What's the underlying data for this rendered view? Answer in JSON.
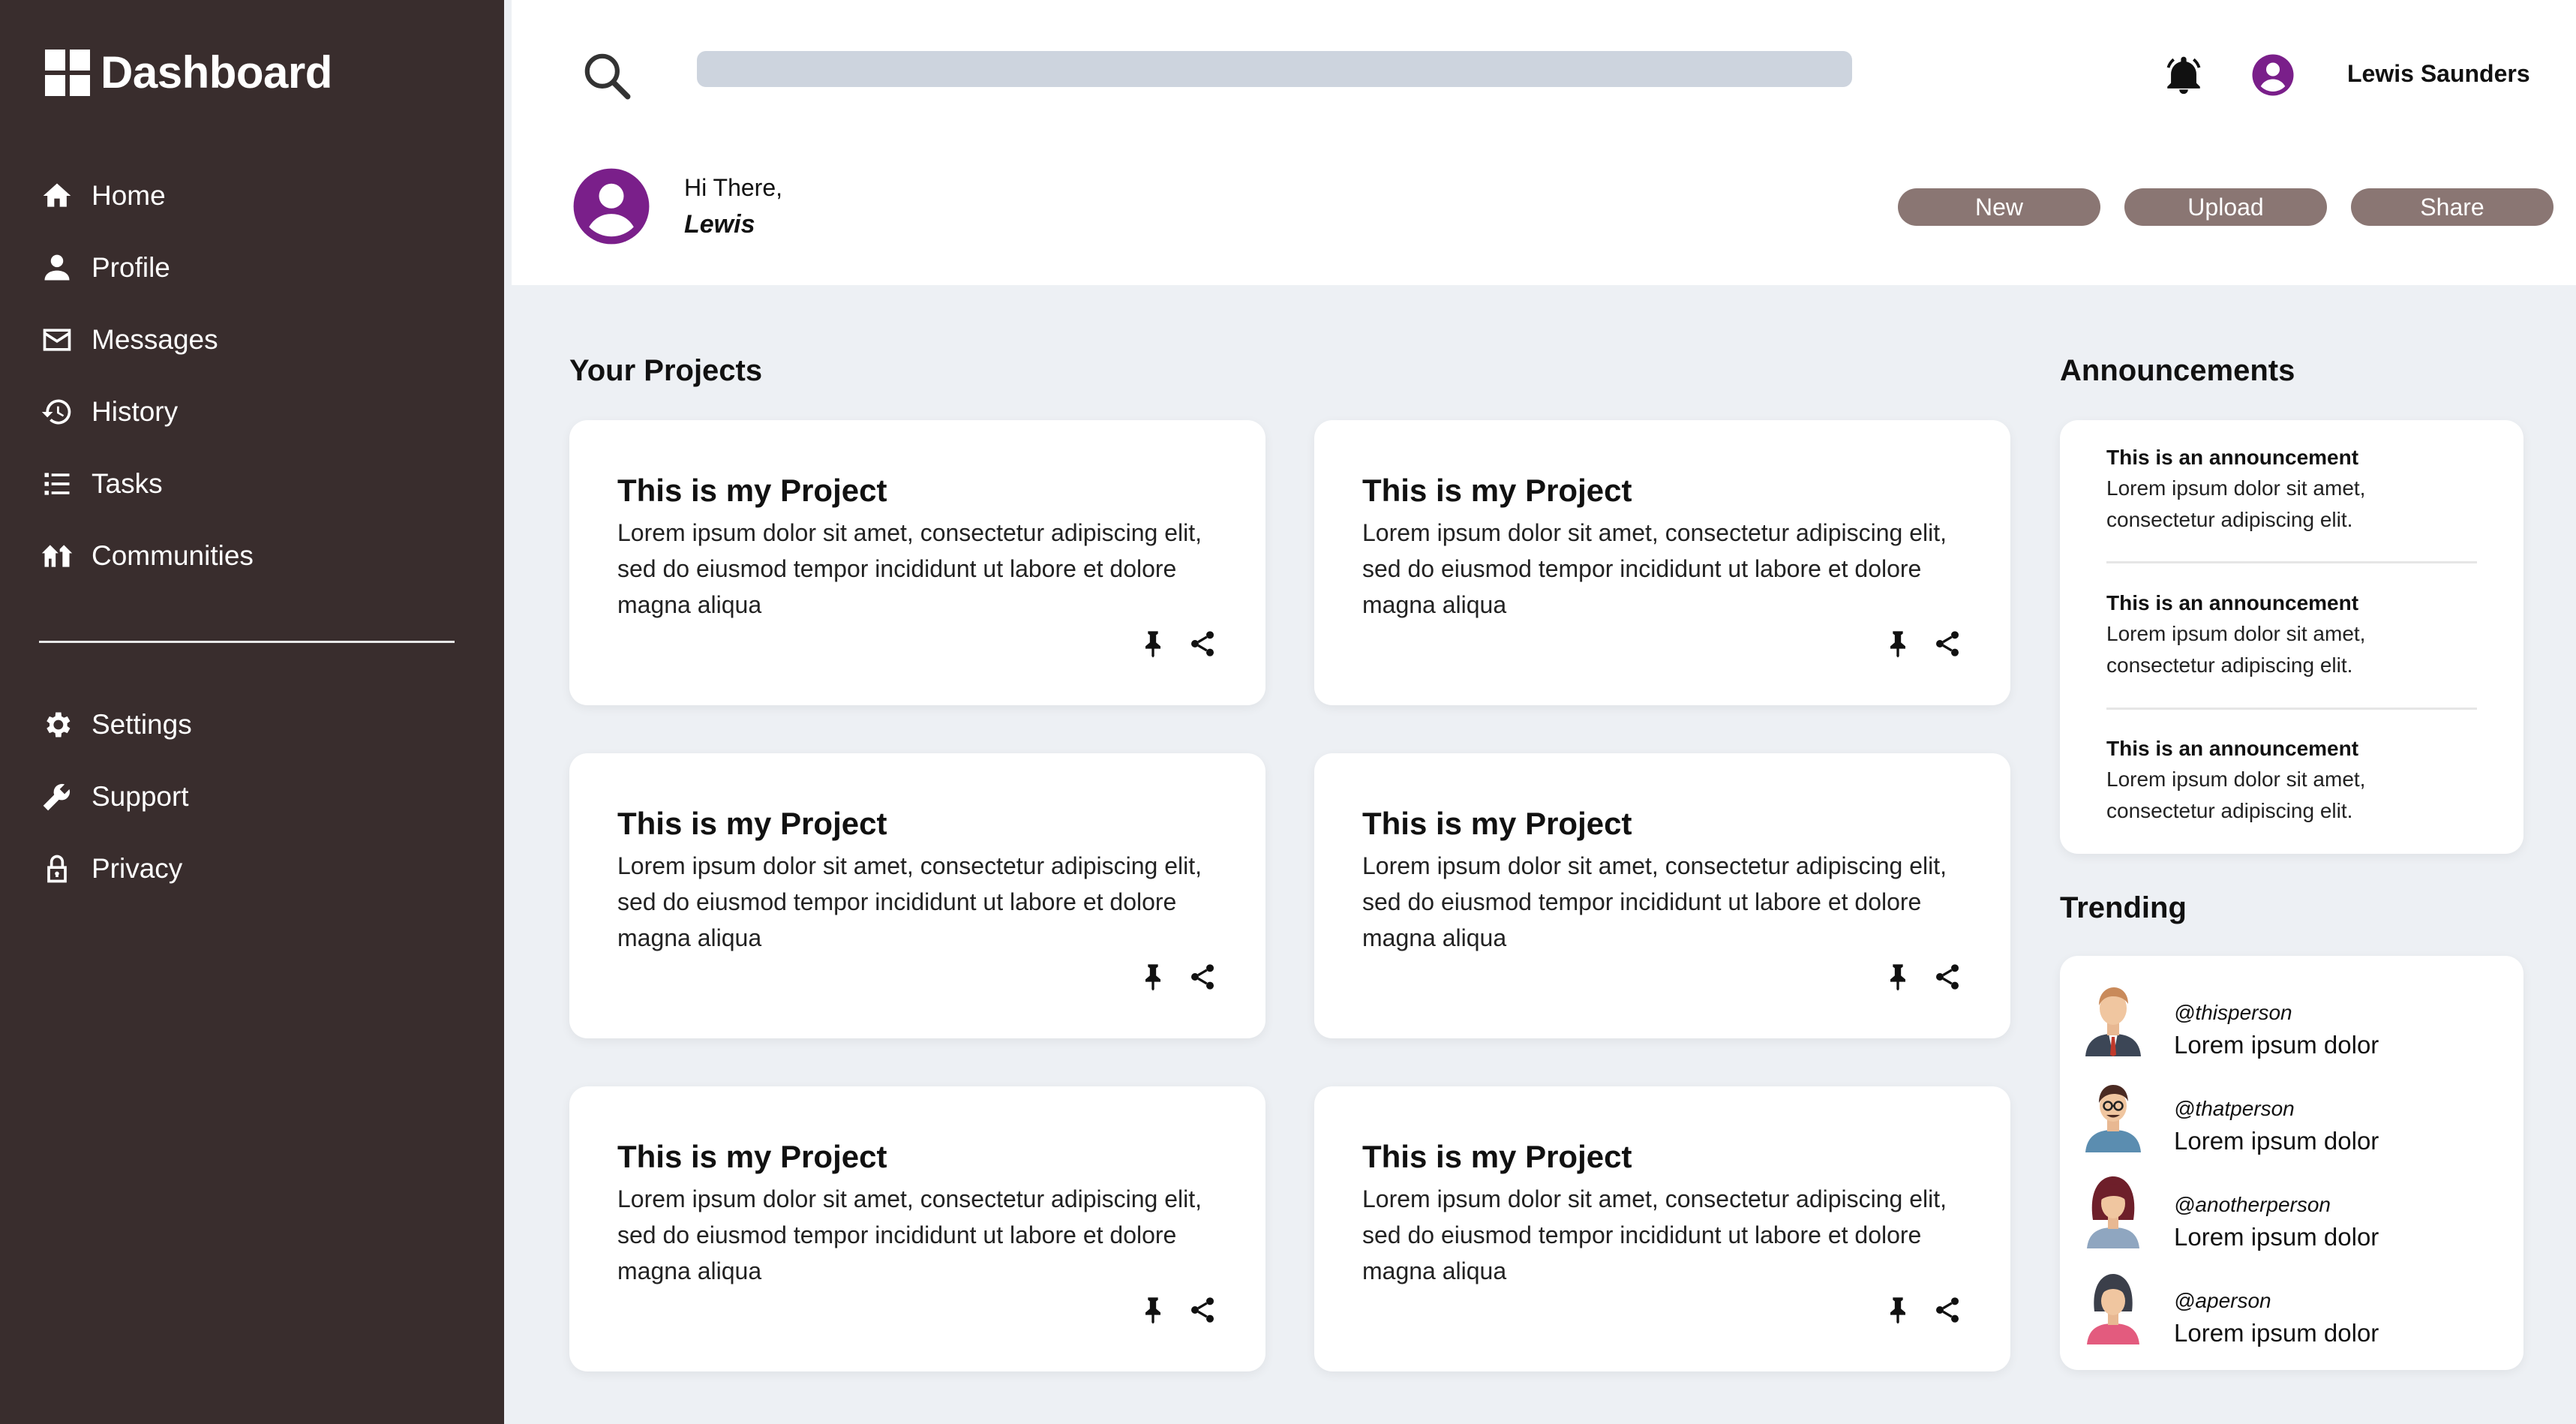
{
  "sidebar": {
    "brand": "Dashboard",
    "items": [
      {
        "label": "Home",
        "icon": "home-icon"
      },
      {
        "label": "Profile",
        "icon": "user-icon"
      },
      {
        "label": "Messages",
        "icon": "mail-icon"
      },
      {
        "label": "History",
        "icon": "history-icon"
      },
      {
        "label": "Tasks",
        "icon": "list-icon"
      },
      {
        "label": "Communities",
        "icon": "communities-icon"
      }
    ],
    "secondary": [
      {
        "label": "Settings",
        "icon": "gear-icon"
      },
      {
        "label": "Support",
        "icon": "wrench-icon"
      },
      {
        "label": "Privacy",
        "icon": "lock-icon"
      }
    ]
  },
  "header": {
    "search": {
      "placeholder": "",
      "value": ""
    },
    "user_name": "Lewis Saunders",
    "greeting": "Hi There,",
    "greeting_name": "Lewis",
    "buttons": {
      "new": "New",
      "upload": "Upload",
      "share": "Share"
    }
  },
  "projects": {
    "title": "Your Projects",
    "items": [
      {
        "title": "This is my Project",
        "body": "Lorem ipsum dolor sit amet, consectetur adipiscing elit, sed do eiusmod tempor incididunt ut labore et dolore magna aliqua"
      },
      {
        "title": "This is my Project",
        "body": "Lorem ipsum dolor sit amet, consectetur adipiscing elit, sed do eiusmod tempor incididunt ut labore et dolore magna aliqua"
      },
      {
        "title": "This is my Project",
        "body": "Lorem ipsum dolor sit amet, consectetur adipiscing elit, sed do eiusmod tempor incididunt ut labore et dolore magna aliqua"
      },
      {
        "title": "This is my Project",
        "body": "Lorem ipsum dolor sit amet, consectetur adipiscing elit, sed do eiusmod tempor incididunt ut labore et dolore magna aliqua"
      },
      {
        "title": "This is my Project",
        "body": "Lorem ipsum dolor sit amet, consectetur adipiscing elit, sed do eiusmod tempor incididunt ut labore et dolore magna aliqua"
      },
      {
        "title": "This is my Project",
        "body": "Lorem ipsum dolor sit amet, consectetur adipiscing elit, sed do eiusmod tempor incididunt ut labore et dolore magna aliqua"
      }
    ]
  },
  "announcements": {
    "title": "Announcements",
    "items": [
      {
        "title": "This is an announcement",
        "body": "Lorem ipsum dolor sit amet, consectetur adipiscing elit."
      },
      {
        "title": "This is an announcement",
        "body": "Lorem ipsum dolor sit amet, consectetur adipiscing elit."
      },
      {
        "title": "This is an announcement",
        "body": "Lorem ipsum dolor sit amet, consectetur adipiscing elit."
      }
    ]
  },
  "trending": {
    "title": "Trending",
    "items": [
      {
        "handle": "@thisperson",
        "text": "Lorem ipsum dolor"
      },
      {
        "handle": "@thatperson",
        "text": "Lorem ipsum dolor"
      },
      {
        "handle": "@anotherperson",
        "text": "Lorem ipsum dolor"
      },
      {
        "handle": "@aperson",
        "text": "Lorem ipsum dolor"
      }
    ]
  },
  "colors": {
    "sidebar": "#392d2d",
    "accent": "#7a1f8a",
    "button": "#8a7673",
    "background": "#edf0f4"
  }
}
